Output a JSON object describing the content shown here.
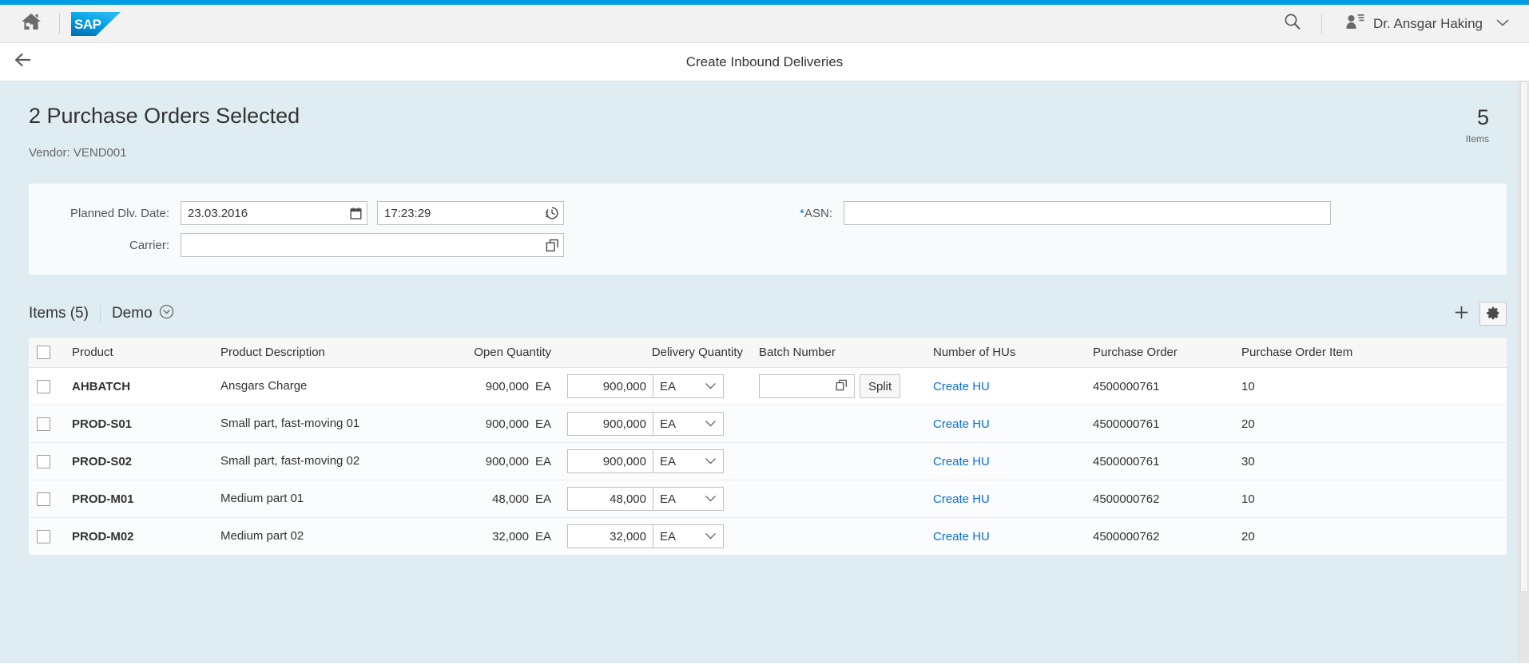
{
  "shell": {
    "home_icon": "home-icon",
    "logo_text": "SAP",
    "search_icon": "search-icon",
    "user_icon": "me-area-person-icon",
    "user_name": "Dr. Ansgar Haking",
    "user_chevron_icon": "chevron-down-icon",
    "accent_color": "#009de0"
  },
  "title_bar": {
    "back_icon": "back-arrow-icon",
    "title": "Create Inbound Deliveries"
  },
  "object_header": {
    "title": "2 Purchase Orders Selected",
    "subtitle": "Vendor: VEND001",
    "kpi_number": "5",
    "kpi_label": "Items"
  },
  "form": {
    "planned_date_label": "Planned Dlv. Date:",
    "planned_date_value": "23.03.2016",
    "planned_date_placeholder": "",
    "planned_date_icon": "calendar-icon",
    "planned_time_value": "17:23:29",
    "planned_time_placeholder": "",
    "planned_time_icon": "clock-icon",
    "carrier_label": "Carrier:",
    "carrier_value": "",
    "carrier_placeholder": "",
    "carrier_icon": "value-help-icon",
    "asn_required_marker": "*",
    "asn_label": "ASN:",
    "asn_value": "",
    "asn_placeholder": ""
  },
  "table_toolbar": {
    "items_title": "Items (5)",
    "variant_label": "Demo",
    "variant_icon": "chevron-down-circle-icon",
    "add_icon": "plus-icon",
    "settings_icon": "gear-icon"
  },
  "table": {
    "columns": [
      {
        "key": "select",
        "label": "",
        "align": "left"
      },
      {
        "key": "product",
        "label": "Product",
        "align": "left"
      },
      {
        "key": "description",
        "label": "Product Description",
        "align": "left"
      },
      {
        "key": "open_quantity",
        "label": "Open Quantity",
        "align": "right"
      },
      {
        "key": "delivery_quantity",
        "label": "Delivery Quantity",
        "align": "right"
      },
      {
        "key": "batch_number",
        "label": "Batch Number",
        "align": "left"
      },
      {
        "key": "number_of_hus",
        "label": "Number of HUs",
        "align": "left"
      },
      {
        "key": "purchase_order",
        "label": "Purchase Order",
        "align": "left"
      },
      {
        "key": "purchase_order_item",
        "label": "Purchase Order Item",
        "align": "left"
      }
    ],
    "split_button_label": "Split",
    "create_hu_label": "Create HU",
    "rows": [
      {
        "selected": false,
        "product": "AHBATCH",
        "description": "Ansgars Charge",
        "open_quantity": "900,000",
        "open_quantity_uom": "EA",
        "delivery_quantity": "900,000",
        "delivery_quantity_uom": "EA",
        "has_batch_field": true,
        "batch_number": "",
        "number_of_hus": "Create HU",
        "purchase_order": "4500000761",
        "purchase_order_item": "10"
      },
      {
        "selected": false,
        "product": "PROD-S01",
        "description": "Small part, fast-moving 01",
        "open_quantity": "900,000",
        "open_quantity_uom": "EA",
        "delivery_quantity": "900,000",
        "delivery_quantity_uom": "EA",
        "has_batch_field": false,
        "batch_number": "",
        "number_of_hus": "Create HU",
        "purchase_order": "4500000761",
        "purchase_order_item": "20"
      },
      {
        "selected": false,
        "product": "PROD-S02",
        "description": "Small part, fast-moving 02",
        "open_quantity": "900,000",
        "open_quantity_uom": "EA",
        "delivery_quantity": "900,000",
        "delivery_quantity_uom": "EA",
        "has_batch_field": false,
        "batch_number": "",
        "number_of_hus": "Create HU",
        "purchase_order": "4500000761",
        "purchase_order_item": "30"
      },
      {
        "selected": false,
        "product": "PROD-M01",
        "description": "Medium part 01",
        "open_quantity": "48,000",
        "open_quantity_uom": "EA",
        "delivery_quantity": "48,000",
        "delivery_quantity_uom": "EA",
        "has_batch_field": false,
        "batch_number": "",
        "number_of_hus": "Create HU",
        "purchase_order": "4500000762",
        "purchase_order_item": "10"
      },
      {
        "selected": false,
        "product": "PROD-M02",
        "description": "Medium part 02",
        "open_quantity": "32,000",
        "open_quantity_uom": "EA",
        "delivery_quantity": "32,000",
        "delivery_quantity_uom": "EA",
        "has_batch_field": false,
        "batch_number": "",
        "number_of_hus": "Create HU",
        "purchase_order": "4500000762",
        "purchase_order_item": "20"
      }
    ]
  },
  "colors": {
    "accent": "#009de0",
    "link": "#0a6ed1",
    "page_background": "#dfedf2",
    "panel_background": "#f7fbfc"
  }
}
